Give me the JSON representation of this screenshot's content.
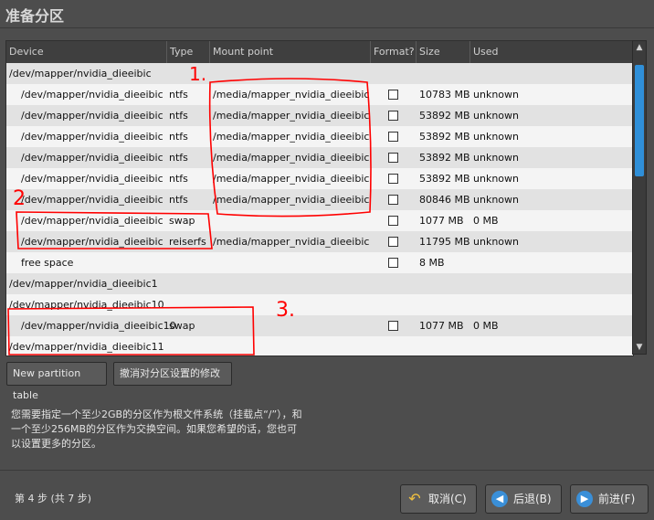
{
  "window": {
    "title": "准备分区"
  },
  "table": {
    "columns": [
      "Device",
      "Type",
      "Mount point",
      "Format?",
      "Size",
      "Used"
    ],
    "rows": [
      {
        "device": "/dev/mapper/nvidia_dieeibic",
        "sub": false,
        "type": "",
        "mount": "",
        "format": false,
        "size": "",
        "used": ""
      },
      {
        "device": "/dev/mapper/nvidia_dieeibic",
        "sub": true,
        "type": "ntfs",
        "mount": "/media/mapper_nvidia_dieeibic",
        "format": true,
        "size": "10783 MB",
        "used": "unknown"
      },
      {
        "device": "/dev/mapper/nvidia_dieeibic",
        "sub": true,
        "type": "ntfs",
        "mount": "/media/mapper_nvidia_dieeibic",
        "format": true,
        "size": "53892 MB",
        "used": "unknown"
      },
      {
        "device": "/dev/mapper/nvidia_dieeibic",
        "sub": true,
        "type": "ntfs",
        "mount": "/media/mapper_nvidia_dieeibic",
        "format": true,
        "size": "53892 MB",
        "used": "unknown"
      },
      {
        "device": "/dev/mapper/nvidia_dieeibic",
        "sub": true,
        "type": "ntfs",
        "mount": "/media/mapper_nvidia_dieeibic",
        "format": true,
        "size": "53892 MB",
        "used": "unknown"
      },
      {
        "device": "/dev/mapper/nvidia_dieeibic",
        "sub": true,
        "type": "ntfs",
        "mount": "/media/mapper_nvidia_dieeibic",
        "format": true,
        "size": "53892 MB",
        "used": "unknown"
      },
      {
        "device": "/dev/mapper/nvidia_dieeibic",
        "sub": true,
        "type": "ntfs",
        "mount": "/media/mapper_nvidia_dieeibic",
        "format": true,
        "size": "80846 MB",
        "used": "unknown"
      },
      {
        "device": "/dev/mapper/nvidia_dieeibic",
        "sub": true,
        "type": "swap",
        "mount": "",
        "format": true,
        "size": "1077 MB",
        "used": "0 MB"
      },
      {
        "device": "/dev/mapper/nvidia_dieeibic",
        "sub": true,
        "type": "reiserfs",
        "mount": "/media/mapper_nvidia_dieeibic",
        "format": true,
        "size": "11795 MB",
        "used": "unknown"
      },
      {
        "device": "free space",
        "sub": true,
        "type": "",
        "mount": "",
        "format": true,
        "size": "8 MB",
        "used": ""
      },
      {
        "device": "/dev/mapper/nvidia_dieeibic1",
        "sub": false,
        "type": "",
        "mount": "",
        "format": false,
        "size": "",
        "used": ""
      },
      {
        "device": "/dev/mapper/nvidia_dieeibic10",
        "sub": false,
        "type": "",
        "mount": "",
        "format": false,
        "size": "",
        "used": ""
      },
      {
        "device": "/dev/mapper/nvidia_dieeibic10",
        "sub": true,
        "type": "swap",
        "mount": "",
        "format": true,
        "size": "1077 MB",
        "used": "0 MB"
      },
      {
        "device": "/dev/mapper/nvidia_dieeibic11",
        "sub": false,
        "type": "",
        "mount": "",
        "format": false,
        "size": "",
        "used": ""
      }
    ]
  },
  "buttons": {
    "new_table": "New partition table",
    "undo": "撤消对分区设置的修改"
  },
  "hint": "您需要指定一个至少2GB的分区作为根文件系统（挂载点“/”），和一个至少256MB的分区作为交换空间。如果您希望的话，您也可以设置更多的分区。",
  "step": "第 4 步 (共 7 步)",
  "nav": {
    "cancel": "取消(C)",
    "back": "后退(B)",
    "forward": "前进(F)"
  },
  "annotations": [
    "1.",
    "2",
    "3."
  ],
  "colors": {
    "annotation": "#ff0000",
    "scroll_thumb": "#2f8fd8"
  }
}
